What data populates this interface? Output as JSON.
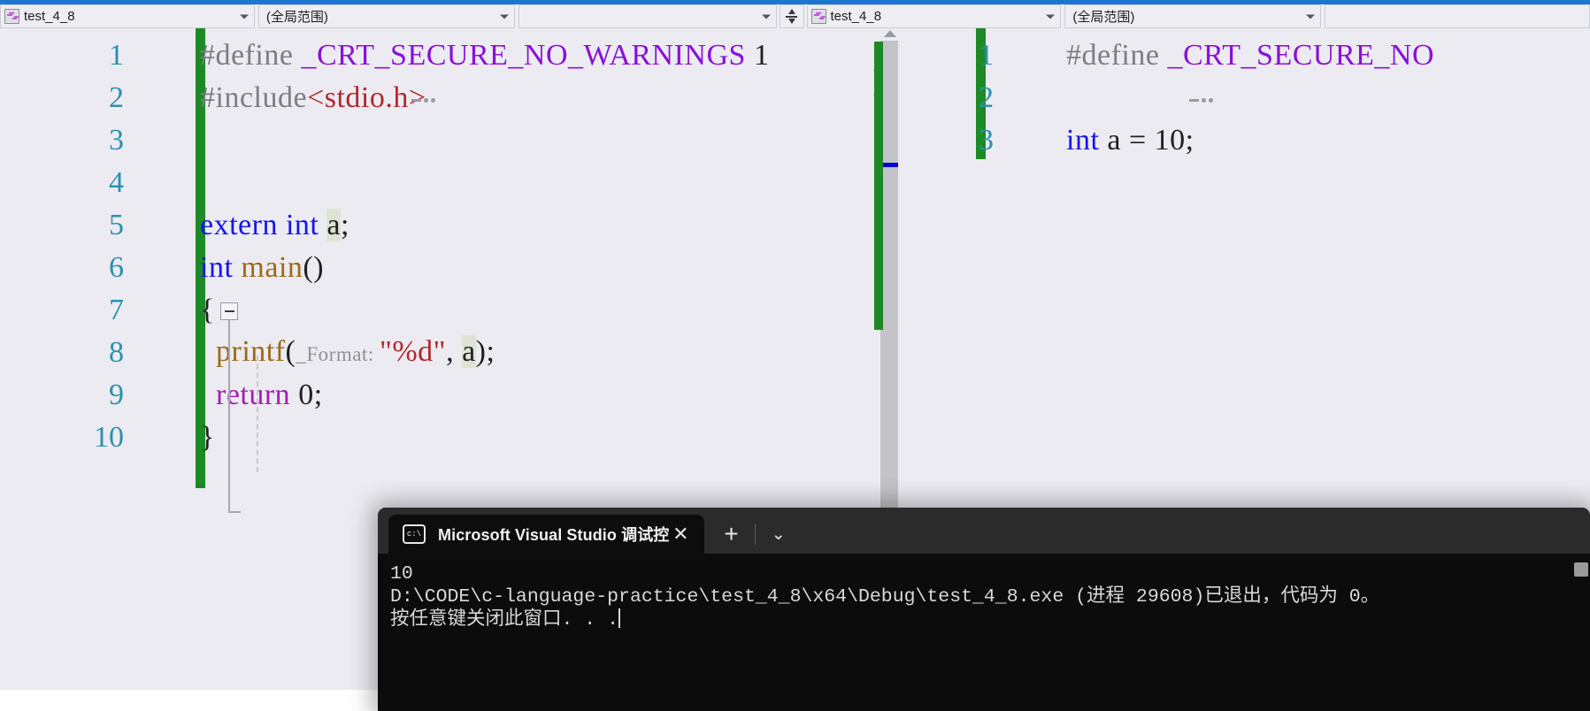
{
  "window": {
    "accent_color": "#1b76d2",
    "editor_bg": "#ecebf1"
  },
  "navbar": {
    "left_pane": {
      "project_combo": {
        "value": "test_4_8",
        "icon": "cpp-file-icon"
      },
      "scope_combo": {
        "value": "(全局范围)"
      },
      "member_combo": {
        "value": ""
      }
    },
    "splitter_button": {
      "icon": "split-window-icon"
    },
    "right_pane": {
      "project_combo": {
        "value": "test_4_8",
        "icon": "cpp-file-icon"
      },
      "scope_combo": {
        "value": "(全局范围)"
      },
      "member_combo": {
        "value": ""
      }
    }
  },
  "editor_left": {
    "line_numbers": [
      "1",
      "2",
      "3",
      "4",
      "5",
      "6",
      "7",
      "8",
      "9",
      "10"
    ],
    "lines": [
      {
        "n": "1",
        "tokens": [
          {
            "t": "#define ",
            "c": "pp"
          },
          {
            "t": "_CRT_SECURE_NO_WARNINGS ",
            "c": "macro"
          },
          {
            "t": "1",
            "c": "num"
          }
        ]
      },
      {
        "n": "2",
        "tokens": [
          {
            "t": "#include",
            "c": "pp"
          },
          {
            "t": "<stdio.h>",
            "c": "str"
          }
        ]
      },
      {
        "n": "3",
        "tokens": []
      },
      {
        "n": "4",
        "tokens": []
      },
      {
        "n": "5",
        "tokens": [
          {
            "t": "extern int ",
            "c": "kw"
          },
          {
            "t": "a",
            "c": "hl"
          },
          {
            "t": ";",
            "c": "num"
          }
        ]
      },
      {
        "n": "6",
        "tokens": [
          {
            "t": "int ",
            "c": "kw"
          },
          {
            "t": "main",
            "c": "fn"
          },
          {
            "t": "()",
            "c": "num"
          }
        ]
      },
      {
        "n": "7",
        "tokens": [
          {
            "t": "{",
            "c": "num"
          }
        ]
      },
      {
        "n": "8",
        "tokens": [
          {
            "t": "  printf",
            "c": "fn"
          },
          {
            "t": "(",
            "c": "num"
          },
          {
            "t": "_Format: ",
            "c": "hint"
          },
          {
            "t": "\"%d\"",
            "c": "str"
          },
          {
            "t": ", ",
            "c": "num"
          },
          {
            "t": "a",
            "c": "hl"
          },
          {
            "t": ");",
            "c": "num"
          }
        ]
      },
      {
        "n": "9",
        "tokens": [
          {
            "t": "  return",
            "c": "ret"
          },
          {
            "t": " 0;",
            "c": "num"
          }
        ]
      },
      {
        "n": "10",
        "tokens": [
          {
            "t": "}",
            "c": "num"
          }
        ]
      }
    ],
    "change_bar_color": "#1d8a26",
    "collapse_marker": "minus",
    "scrollbar": {
      "marker_color": "#0000d8",
      "thumb_color": "#c3c3c8"
    }
  },
  "editor_right": {
    "line_numbers": [
      "1",
      "2",
      "3"
    ],
    "lines": [
      {
        "n": "1",
        "tokens": [
          {
            "t": "#define ",
            "c": "pp"
          },
          {
            "t": "_CRT_SECURE_NO",
            "c": "macro"
          }
        ]
      },
      {
        "n": "2",
        "tokens": []
      },
      {
        "n": "3",
        "tokens": [
          {
            "t": "int ",
            "c": "kw"
          },
          {
            "t": "a = 10;",
            "c": "num"
          }
        ]
      }
    ],
    "change_bar_color": "#1d8a26"
  },
  "terminal": {
    "tab": {
      "title": "Microsoft Visual Studio 调试控",
      "icon": "console-icon",
      "close_label": "✕"
    },
    "new_tab_label": "+",
    "dropdown_label": "⌄",
    "output_lines": [
      "10",
      "D:\\CODE\\c-language-practice\\test_4_8\\x64\\Debug\\test_4_8.exe (进程 29608)已退出，代码为 0。",
      "按任意键关闭此窗口. . ."
    ]
  }
}
